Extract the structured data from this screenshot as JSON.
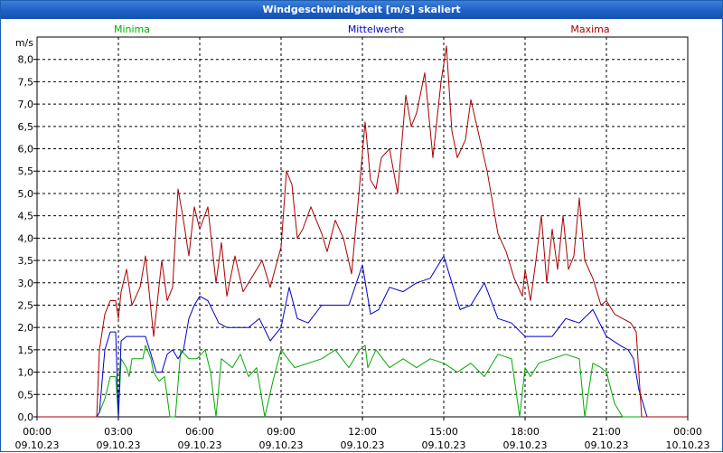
{
  "window": {
    "title": "Windgeschwindigkeit [m/s] skaliert"
  },
  "chart_data": {
    "type": "line",
    "title": "Windgeschwindigkeit [m/s] skaliert",
    "ylabel": "m/s",
    "ylim": [
      0,
      8.5
    ],
    "xlim": [
      0,
      24
    ],
    "grid": true,
    "y_ticks": [
      "0,0",
      "0,5",
      "1,0",
      "1,5",
      "2,0",
      "2,5",
      "3,0",
      "3,5",
      "4,0",
      "4,5",
      "5,0",
      "5,5",
      "6,0",
      "6,5",
      "7,0",
      "7,5",
      "8,0"
    ],
    "x_ticks": [
      {
        "time": "00:00",
        "date": "09.10.23"
      },
      {
        "time": "03:00",
        "date": "09.10.23"
      },
      {
        "time": "06:00",
        "date": "09.10.23"
      },
      {
        "time": "09:00",
        "date": "09.10.23"
      },
      {
        "time": "12:00",
        "date": "09.10.23"
      },
      {
        "time": "15:00",
        "date": "09.10.23"
      },
      {
        "time": "18:00",
        "date": "09.10.23"
      },
      {
        "time": "21:00",
        "date": "09.10.23"
      },
      {
        "time": "00:00",
        "date": "10.10.23"
      }
    ],
    "series": [
      {
        "name": "Minima",
        "color": "#00aa00",
        "points": [
          [
            0,
            0
          ],
          [
            2.2,
            0
          ],
          [
            2.3,
            0.1
          ],
          [
            2.5,
            0.4
          ],
          [
            2.7,
            0.9
          ],
          [
            2.9,
            0.9
          ],
          [
            3.0,
            0
          ],
          [
            3.1,
            1.3
          ],
          [
            3.3,
            1.1
          ],
          [
            3.4,
            0.9
          ],
          [
            3.5,
            1.3
          ],
          [
            3.7,
            1.3
          ],
          [
            3.9,
            1.3
          ],
          [
            4.0,
            1.6
          ],
          [
            4.2,
            1.3
          ],
          [
            4.3,
            1.0
          ],
          [
            4.5,
            0.8
          ],
          [
            4.7,
            0.9
          ],
          [
            4.9,
            0
          ],
          [
            5.1,
            0
          ],
          [
            5.3,
            1.5
          ],
          [
            5.6,
            1.3
          ],
          [
            5.9,
            1.3
          ],
          [
            6.2,
            1.5
          ],
          [
            6.4,
            1.0
          ],
          [
            6.6,
            0
          ],
          [
            6.8,
            1.3
          ],
          [
            7.2,
            1.1
          ],
          [
            7.5,
            1.4
          ],
          [
            7.8,
            0.9
          ],
          [
            8.1,
            1.1
          ],
          [
            8.4,
            0
          ],
          [
            8.7,
            0.8
          ],
          [
            9.0,
            1.5
          ],
          [
            9.5,
            1.1
          ],
          [
            10.0,
            1.2
          ],
          [
            10.5,
            1.3
          ],
          [
            11.0,
            1.5
          ],
          [
            11.5,
            1.1
          ],
          [
            11.9,
            1.5
          ],
          [
            12.1,
            1.6
          ],
          [
            12.2,
            1.1
          ],
          [
            12.5,
            1.5
          ],
          [
            13.0,
            1.1
          ],
          [
            13.5,
            1.3
          ],
          [
            14.0,
            1.1
          ],
          [
            14.5,
            1.3
          ],
          [
            15.0,
            1.2
          ],
          [
            15.5,
            1.0
          ],
          [
            16.0,
            1.2
          ],
          [
            16.5,
            0.9
          ],
          [
            17.0,
            1.4
          ],
          [
            17.5,
            1.3
          ],
          [
            17.8,
            0
          ],
          [
            18.0,
            1.1
          ],
          [
            18.2,
            0.9
          ],
          [
            18.5,
            1.2
          ],
          [
            19.0,
            1.3
          ],
          [
            19.5,
            1.4
          ],
          [
            20.0,
            1.3
          ],
          [
            20.2,
            0
          ],
          [
            20.5,
            1.2
          ],
          [
            20.8,
            1.1
          ],
          [
            21.0,
            1.0
          ],
          [
            21.3,
            0.3
          ],
          [
            21.6,
            0
          ],
          [
            22.0,
            0
          ],
          [
            24,
            0
          ]
        ]
      },
      {
        "name": "Mittelwerte",
        "color": "#0000cc",
        "points": [
          [
            0,
            0
          ],
          [
            2.2,
            0
          ],
          [
            2.3,
            0.1
          ],
          [
            2.5,
            1.5
          ],
          [
            2.7,
            1.9
          ],
          [
            2.9,
            1.9
          ],
          [
            3.0,
            0
          ],
          [
            3.1,
            1.7
          ],
          [
            3.3,
            1.8
          ],
          [
            3.6,
            1.8
          ],
          [
            4.0,
            1.8
          ],
          [
            4.2,
            1.4
          ],
          [
            4.4,
            1.0
          ],
          [
            4.6,
            1.0
          ],
          [
            4.8,
            1.4
          ],
          [
            5.0,
            1.5
          ],
          [
            5.2,
            1.3
          ],
          [
            5.4,
            1.5
          ],
          [
            5.6,
            2.2
          ],
          [
            5.8,
            2.5
          ],
          [
            6.0,
            2.7
          ],
          [
            6.3,
            2.6
          ],
          [
            6.7,
            2.1
          ],
          [
            7.0,
            2.0
          ],
          [
            7.4,
            2.0
          ],
          [
            7.8,
            2.0
          ],
          [
            8.2,
            2.2
          ],
          [
            8.6,
            1.7
          ],
          [
            9.0,
            2.0
          ],
          [
            9.3,
            2.9
          ],
          [
            9.6,
            2.2
          ],
          [
            10.0,
            2.1
          ],
          [
            10.5,
            2.5
          ],
          [
            11.0,
            2.5
          ],
          [
            11.5,
            2.5
          ],
          [
            12.0,
            3.4
          ],
          [
            12.3,
            2.3
          ],
          [
            12.6,
            2.4
          ],
          [
            13.0,
            2.9
          ],
          [
            13.5,
            2.8
          ],
          [
            14.0,
            3.0
          ],
          [
            14.5,
            3.1
          ],
          [
            15.0,
            3.6
          ],
          [
            15.3,
            3.0
          ],
          [
            15.6,
            2.4
          ],
          [
            16.0,
            2.5
          ],
          [
            16.5,
            3.0
          ],
          [
            17.0,
            2.2
          ],
          [
            17.5,
            2.1
          ],
          [
            18.0,
            1.8
          ],
          [
            18.5,
            1.8
          ],
          [
            19.0,
            1.8
          ],
          [
            19.5,
            2.2
          ],
          [
            20.0,
            2.1
          ],
          [
            20.5,
            2.4
          ],
          [
            21.0,
            1.8
          ],
          [
            21.5,
            1.6
          ],
          [
            21.8,
            1.5
          ],
          [
            22.0,
            1.3
          ],
          [
            22.2,
            0.6
          ],
          [
            22.5,
            0
          ],
          [
            24,
            0
          ]
        ]
      },
      {
        "name": "Maxima",
        "color": "#aa0000",
        "points": [
          [
            0,
            0
          ],
          [
            2.2,
            0
          ],
          [
            2.3,
            1.5
          ],
          [
            2.5,
            2.3
          ],
          [
            2.7,
            2.6
          ],
          [
            2.9,
            2.6
          ],
          [
            3.0,
            2.2
          ],
          [
            3.1,
            2.8
          ],
          [
            3.3,
            3.3
          ],
          [
            3.5,
            2.5
          ],
          [
            3.8,
            2.9
          ],
          [
            4.0,
            3.6
          ],
          [
            4.3,
            1.8
          ],
          [
            4.6,
            3.5
          ],
          [
            4.8,
            2.6
          ],
          [
            5.0,
            2.9
          ],
          [
            5.2,
            5.1
          ],
          [
            5.4,
            4.4
          ],
          [
            5.6,
            3.6
          ],
          [
            5.8,
            4.7
          ],
          [
            6.0,
            4.2
          ],
          [
            6.3,
            4.7
          ],
          [
            6.6,
            3.0
          ],
          [
            6.8,
            3.9
          ],
          [
            7.0,
            2.7
          ],
          [
            7.3,
            3.6
          ],
          [
            7.6,
            2.8
          ],
          [
            8.0,
            3.2
          ],
          [
            8.3,
            3.5
          ],
          [
            8.6,
            2.9
          ],
          [
            9.0,
            3.8
          ],
          [
            9.2,
            5.5
          ],
          [
            9.4,
            5.2
          ],
          [
            9.6,
            4.0
          ],
          [
            9.8,
            4.2
          ],
          [
            10.1,
            4.7
          ],
          [
            10.5,
            4.1
          ],
          [
            10.7,
            3.7
          ],
          [
            11.0,
            4.4
          ],
          [
            11.3,
            4.0
          ],
          [
            11.6,
            3.2
          ],
          [
            11.9,
            5.2
          ],
          [
            12.1,
            6.6
          ],
          [
            12.3,
            5.3
          ],
          [
            12.5,
            5.1
          ],
          [
            12.7,
            5.8
          ],
          [
            13.0,
            6.0
          ],
          [
            13.3,
            5.0
          ],
          [
            13.6,
            7.2
          ],
          [
            13.8,
            6.5
          ],
          [
            14.0,
            6.8
          ],
          [
            14.3,
            7.7
          ],
          [
            14.6,
            5.8
          ],
          [
            14.9,
            7.5
          ],
          [
            15.1,
            8.3
          ],
          [
            15.3,
            6.4
          ],
          [
            15.5,
            5.8
          ],
          [
            15.8,
            6.2
          ],
          [
            16.0,
            7.1
          ],
          [
            16.3,
            6.3
          ],
          [
            16.6,
            5.5
          ],
          [
            17.0,
            4.1
          ],
          [
            17.3,
            3.7
          ],
          [
            17.6,
            3.1
          ],
          [
            17.9,
            2.7
          ],
          [
            18.0,
            3.3
          ],
          [
            18.2,
            2.6
          ],
          [
            18.4,
            3.5
          ],
          [
            18.6,
            4.5
          ],
          [
            18.8,
            3.0
          ],
          [
            19.0,
            4.2
          ],
          [
            19.2,
            3.3
          ],
          [
            19.4,
            4.5
          ],
          [
            19.6,
            3.3
          ],
          [
            19.8,
            3.6
          ],
          [
            20.0,
            4.9
          ],
          [
            20.2,
            3.5
          ],
          [
            20.5,
            3.1
          ],
          [
            20.8,
            2.5
          ],
          [
            21.0,
            2.6
          ],
          [
            21.3,
            2.3
          ],
          [
            21.6,
            2.2
          ],
          [
            21.9,
            2.1
          ],
          [
            22.1,
            1.9
          ],
          [
            22.3,
            0
          ],
          [
            24,
            0
          ]
        ]
      }
    ]
  }
}
